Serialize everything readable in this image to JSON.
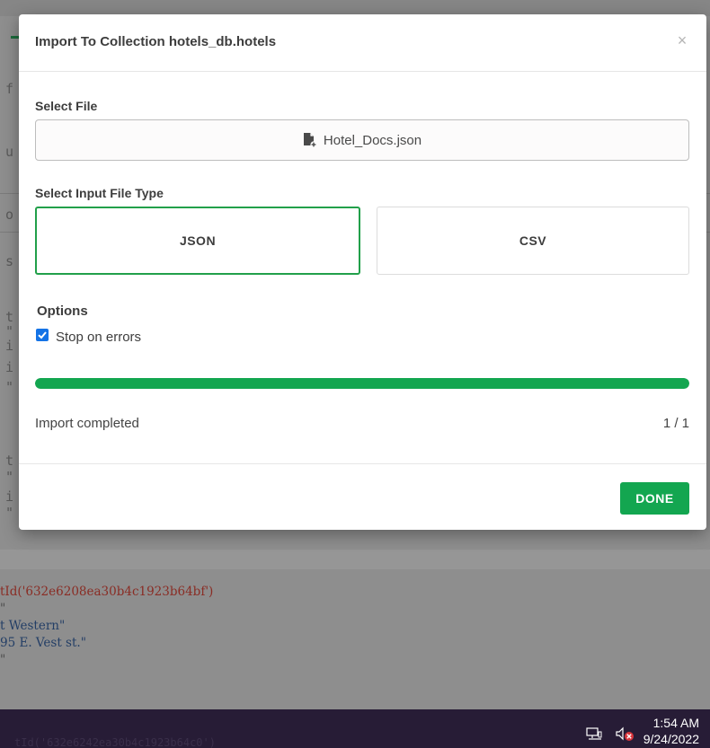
{
  "background": {
    "left_letters": [
      "f",
      "u",
      "o",
      "s",
      "t",
      "\"",
      "i",
      "i",
      "\"",
      "t",
      "\"",
      "i",
      "\""
    ],
    "code_lines": [
      {
        "text": "tId('632e6208ea30b4c1923b64bf')",
        "color": "red"
      },
      {
        "text": "\"",
        "color": "grey"
      },
      {
        "text": "t Western\"",
        "color": "blue"
      },
      {
        "text": "95 E. Vest st.\"",
        "color": "blue"
      },
      {
        "text": "\"",
        "color": "grey"
      }
    ],
    "ghost_line": "tId('632e6242ea30b4c1923b64c0')"
  },
  "dialog": {
    "title": "Import To Collection hotels_db.hotels",
    "close_label": "×",
    "select_file_label": "Select File",
    "file_name": "Hotel_Docs.json",
    "file_icon": "file-add-icon",
    "input_type_label": "Select Input File Type",
    "file_types": [
      {
        "label": "JSON",
        "selected": true
      },
      {
        "label": "CSV",
        "selected": false
      }
    ],
    "options_label": "Options",
    "stop_on_errors": {
      "label": "Stop on errors",
      "checked": true
    },
    "progress": {
      "fraction": 1.0
    },
    "status_text": "Import completed",
    "count_text": "1 / 1",
    "done_label": "DONE"
  },
  "taskbar": {
    "time": "1:54 AM",
    "date": "9/24/2022",
    "icons": [
      "network-icon",
      "volume-muted-icon"
    ]
  },
  "colors": {
    "accent_green": "#13a650",
    "selected_border": "#22a04a",
    "checkbox_blue": "#1473e6",
    "taskbar": "#271c36"
  }
}
